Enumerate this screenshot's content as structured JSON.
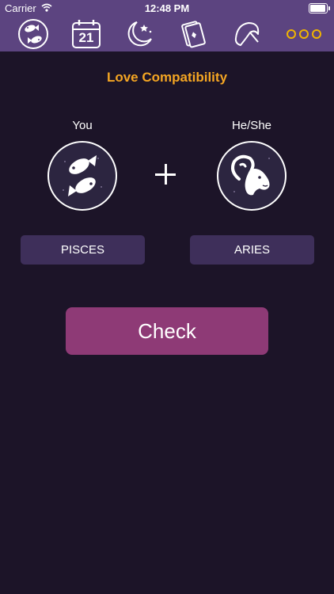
{
  "status_bar": {
    "carrier": "Carrier",
    "time": "12:48 PM"
  },
  "tabs": [
    {
      "icon": "pisces-zodiac-icon"
    },
    {
      "icon": "calendar-icon",
      "day": "21"
    },
    {
      "icon": "moon-stars-icon"
    },
    {
      "icon": "tarot-cards-icon"
    },
    {
      "icon": "fortune-cookie-icon"
    },
    {
      "icon": "more-dots-icon"
    }
  ],
  "page": {
    "title": "Love Compatibility"
  },
  "you": {
    "label": "You",
    "sign": "PISCES",
    "icon": "pisces-fish-icon"
  },
  "partner": {
    "label": "He/She",
    "sign": "ARIES",
    "icon": "aries-ram-icon"
  },
  "check_button": {
    "label": "Check"
  },
  "colors": {
    "accent": "#f5a623",
    "nav": "#5c4480",
    "background": "#1c1428",
    "button": "#8e3a76",
    "dots": "#f0b400"
  }
}
